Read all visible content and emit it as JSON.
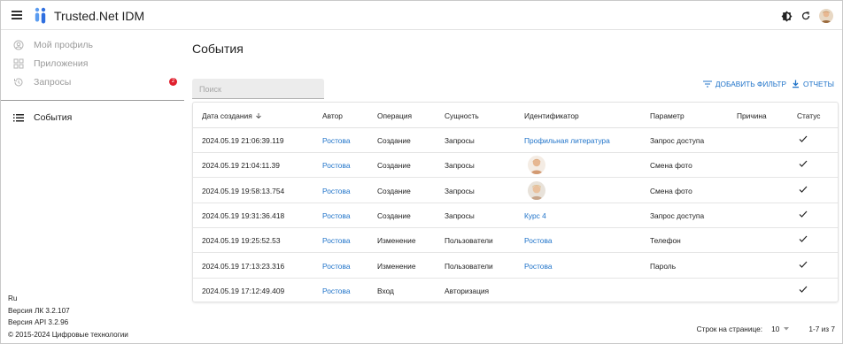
{
  "app": {
    "title": "Trusted.Net IDM"
  },
  "sidebar": {
    "items": [
      {
        "label": "Мой профиль",
        "icon": "user-circle-icon"
      },
      {
        "label": "Приложения",
        "icon": "apps-grid-icon"
      },
      {
        "label": "Запросы",
        "icon": "history-icon",
        "badge": "2"
      },
      {
        "label": "События",
        "icon": "list-icon"
      }
    ],
    "footer": {
      "lang": "Ru",
      "version_lk": "Версия ЛК 3.2.107",
      "version_api": "Версия API 3.2.96",
      "copyright": "© 2015-2024 Цифровые технологии"
    }
  },
  "page": {
    "title": "События"
  },
  "search": {
    "placeholder": "Поиск"
  },
  "actions": {
    "add_filter": "ДОБАВИТЬ ФИЛЬТР",
    "reports": "ОТЧЕТЫ"
  },
  "table": {
    "headers": [
      "Дата создания",
      "Автор",
      "Операция",
      "Сущность",
      "Идентификатор",
      "Параметр",
      "Причина",
      "Статус"
    ],
    "rows": [
      {
        "date": "2024.05.19 21:06:39.119",
        "author": "Ростова",
        "operation": "Создание",
        "entity": "Запросы",
        "identifier": "Профильная литература",
        "identifier_type": "link",
        "parameter": "Запрос доступа",
        "reason": "",
        "status": "success"
      },
      {
        "date": "2024.05.19 21:04:11.39",
        "author": "Ростова",
        "operation": "Создание",
        "entity": "Запросы",
        "identifier": "",
        "identifier_type": "photo",
        "parameter": "Смена фото",
        "reason": "",
        "status": "success"
      },
      {
        "date": "2024.05.19 19:58:13.754",
        "author": "Ростова",
        "operation": "Создание",
        "entity": "Запросы",
        "identifier": "",
        "identifier_type": "photo",
        "parameter": "Смена фото",
        "reason": "",
        "status": "success"
      },
      {
        "date": "2024.05.19 19:31:36.418",
        "author": "Ростова",
        "operation": "Создание",
        "entity": "Запросы",
        "identifier": "Курс 4",
        "identifier_type": "link",
        "parameter": "Запрос доступа",
        "reason": "",
        "status": "success"
      },
      {
        "date": "2024.05.19 19:25:52.53",
        "author": "Ростова",
        "operation": "Изменение",
        "entity": "Пользователи",
        "identifier": "Ростова",
        "identifier_type": "link",
        "parameter": "Телефон",
        "reason": "",
        "status": "success"
      },
      {
        "date": "2024.05.19 17:13:23.316",
        "author": "Ростова",
        "operation": "Изменение",
        "entity": "Пользователи",
        "identifier": "Ростова",
        "identifier_type": "link",
        "parameter": "Пароль",
        "reason": "",
        "status": "success"
      },
      {
        "date": "2024.05.19 17:12:49.409",
        "author": "Ростова",
        "operation": "Вход",
        "entity": "Авторизация",
        "identifier": "",
        "identifier_type": "none",
        "parameter": "",
        "reason": "",
        "status": "success"
      }
    ]
  },
  "pagination": {
    "rows_per_page_label": "Строк на странице:",
    "rows_per_page": "10",
    "range": "1-7 из 7"
  },
  "colors": {
    "accent": "#1f73c9",
    "badge": "#e0202e",
    "logo": "#2f6fe0"
  }
}
